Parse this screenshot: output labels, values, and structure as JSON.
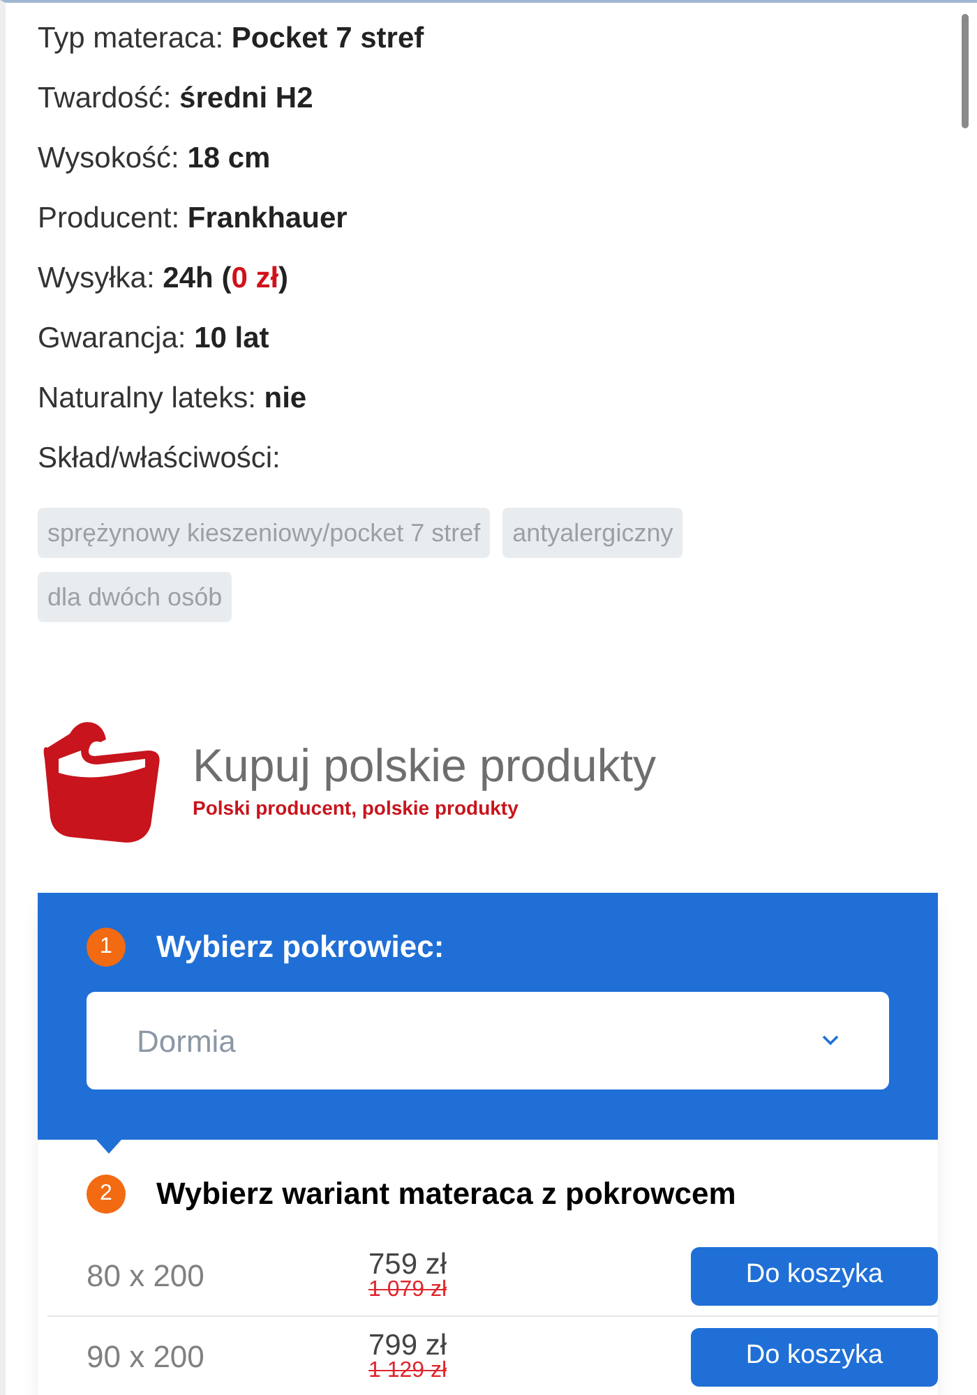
{
  "specs": [
    {
      "label": "Typ materaca:",
      "value": [
        {
          "kind": "bold",
          "text": "Pocket 7 stref"
        }
      ]
    },
    {
      "label": "Twardość:",
      "value": [
        {
          "kind": "bold",
          "text": "średni H2"
        }
      ]
    },
    {
      "label": "Wysokość:",
      "value": [
        {
          "kind": "bold",
          "text": "18 cm"
        }
      ]
    },
    {
      "label": "Producent:",
      "value": [
        {
          "kind": "bold",
          "text": "Frankhauer"
        }
      ]
    },
    {
      "label": "Wysyłka:",
      "value": [
        {
          "kind": "bold",
          "text": "24h ("
        },
        {
          "kind": "price",
          "text": "0 zł"
        },
        {
          "kind": "bold",
          "text": ")"
        }
      ]
    },
    {
      "label": "Gwarancja:",
      "value": [
        {
          "kind": "bold",
          "text": "10 lat"
        }
      ]
    },
    {
      "label": "Naturalny lateks:",
      "value": [
        {
          "kind": "bold",
          "text": "nie"
        }
      ]
    },
    {
      "label": "Skład/właściwości:"
    }
  ],
  "tags": [
    "sprężynowy kieszeniowy/pocket 7 stref",
    "antyalergiczny",
    "dla dwóch osób"
  ],
  "banner": {
    "title": "Kupuj polskie produkty",
    "subtitle": "Polski producent, polskie produkty"
  },
  "step1": {
    "number": "1",
    "title": "Wybierz pokrowiec:",
    "select": {
      "value": "Dormia"
    }
  },
  "step2": {
    "number": "2",
    "title": "Wybierz wariant materaca z pokrowcem"
  },
  "variants": [
    {
      "size": "80 x 200",
      "price": "759 zł",
      "old_price": "1 079 zł",
      "button": "Do koszyka"
    },
    {
      "size": "90 x 200",
      "price": "799 zł",
      "old_price": "1 129 zł",
      "button": "Do koszyka"
    }
  ]
}
